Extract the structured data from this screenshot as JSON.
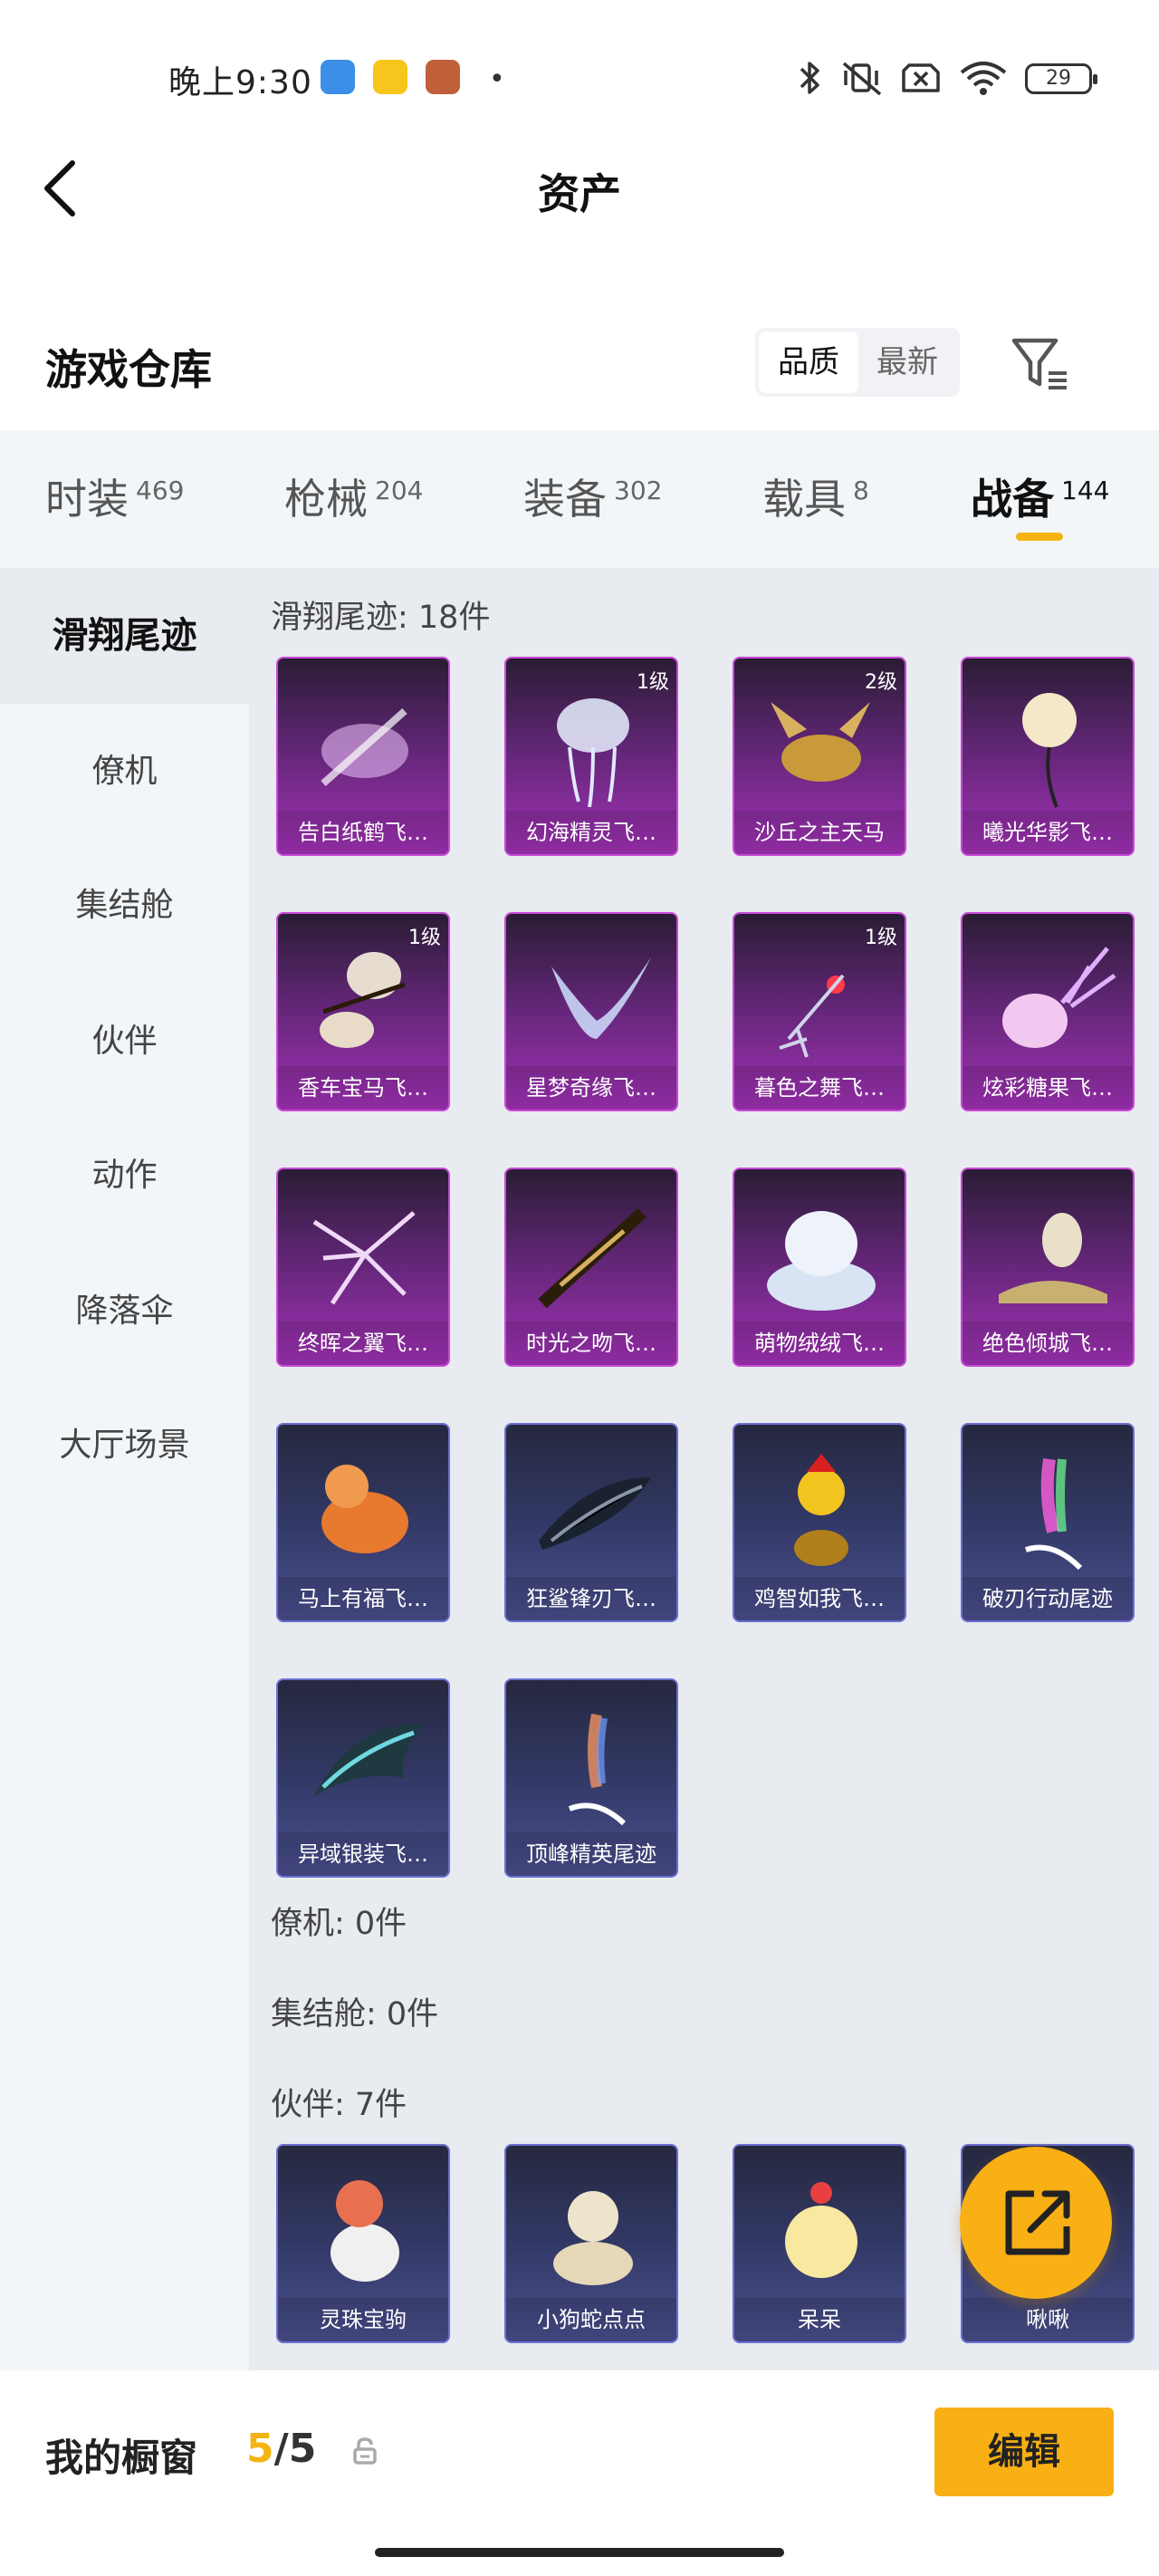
{
  "status_bar": {
    "time": "晚上9:30",
    "battery": "29",
    "icons": [
      "bluetooth-icon",
      "mute-vibrate-icon",
      "sim-error-icon",
      "wifi-icon",
      "battery-icon"
    ]
  },
  "header": {
    "title": "资产"
  },
  "section": {
    "title": "游戏仓库",
    "sort_options": [
      "品质",
      "最新"
    ],
    "selected_sort": "品质"
  },
  "category_tabs": [
    {
      "label": "时装",
      "count": "469"
    },
    {
      "label": "枪械",
      "count": "204"
    },
    {
      "label": "装备",
      "count": "302"
    },
    {
      "label": "载具",
      "count": "8"
    },
    {
      "label": "战备",
      "count": "144",
      "active": true
    }
  ],
  "sidebar": {
    "items": [
      "滑翔尾迹",
      "僚机",
      "集结舱",
      "伙伴",
      "动作",
      "降落伞",
      "大厅场景"
    ],
    "selected": "滑翔尾迹"
  },
  "groups": {
    "glide": {
      "title": "滑翔尾迹: 18件",
      "items": [
        {
          "name": "告白纸鹤飞…",
          "level": "",
          "rarity": "purple"
        },
        {
          "name": "幻海精灵飞…",
          "level": "1级",
          "rarity": "purple"
        },
        {
          "name": "沙丘之主天马",
          "level": "2级",
          "rarity": "purple"
        },
        {
          "name": "曦光华影飞…",
          "level": "",
          "rarity": "purple"
        },
        {
          "name": "香车宝马飞…",
          "level": "1级",
          "rarity": "purple"
        },
        {
          "name": "星梦奇缘飞…",
          "level": "",
          "rarity": "purple"
        },
        {
          "name": "暮色之舞飞…",
          "level": "1级",
          "rarity": "purple"
        },
        {
          "name": "炫彩糖果飞…",
          "level": "",
          "rarity": "purple"
        },
        {
          "name": "终晖之翼飞…",
          "level": "",
          "rarity": "purple"
        },
        {
          "name": "时光之吻飞…",
          "level": "",
          "rarity": "purple"
        },
        {
          "name": "萌物绒绒飞…",
          "level": "",
          "rarity": "purple"
        },
        {
          "name": "绝色倾城飞…",
          "level": "",
          "rarity": "purple"
        },
        {
          "name": "马上有福飞…",
          "level": "",
          "rarity": "blue"
        },
        {
          "name": "狂鲨锋刃飞…",
          "level": "",
          "rarity": "blue"
        },
        {
          "name": "鸡智如我飞…",
          "level": "",
          "rarity": "blue"
        },
        {
          "name": "破刃行动尾迹",
          "level": "",
          "rarity": "blue"
        },
        {
          "name": "异域银装飞…",
          "level": "",
          "rarity": "blue"
        },
        {
          "name": "顶峰精英尾迹",
          "level": "",
          "rarity": "blue"
        }
      ]
    },
    "wingman": {
      "title": "僚机: 0件"
    },
    "pod": {
      "title": "集结舱: 0件"
    },
    "partner": {
      "title": "伙伴: 7件",
      "items": [
        {
          "name": "灵珠宝驹",
          "level": "",
          "rarity": "blue"
        },
        {
          "name": "小狗蛇点点",
          "level": "",
          "rarity": "blue"
        },
        {
          "name": "呆呆",
          "level": "",
          "rarity": "blue"
        },
        {
          "name": "啾啾",
          "level": "",
          "rarity": "blue"
        }
      ]
    }
  },
  "bottom": {
    "label": "我的橱窗",
    "current": "5",
    "separator": "/",
    "total": "5",
    "edit_label": "编辑"
  },
  "colors": {
    "accent": "#f9b014",
    "purple_card": "#a332b8",
    "blue_card": "#4a4f8e",
    "panel_bg": "#e8ebf0"
  }
}
